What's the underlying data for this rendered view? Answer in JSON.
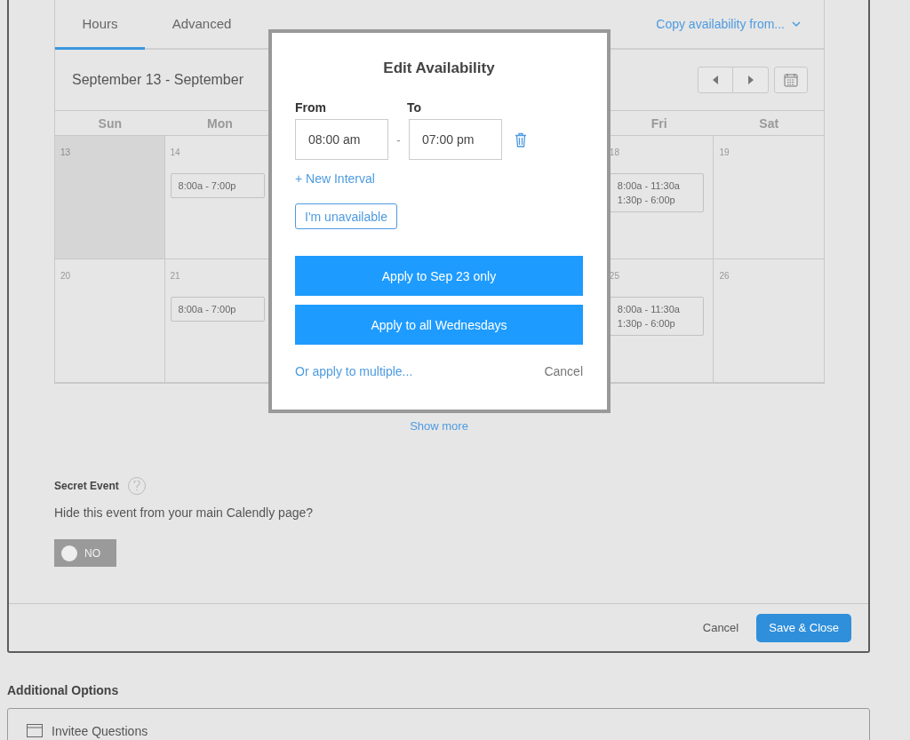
{
  "availability": {
    "tabs": [
      {
        "label": "Hours",
        "selected": true
      },
      {
        "label": "Advanced",
        "selected": false
      }
    ],
    "copy_link": "Copy availability from...",
    "date_range": "September 13 - September",
    "days_before_dialog": [
      {
        "label": "Sun"
      },
      {
        "label": "Mon"
      }
    ],
    "days_after_dialog": [
      {
        "label": "Fri"
      },
      {
        "label": "Sat"
      }
    ],
    "weeks": [
      {
        "before_dialog": [
          {
            "date": "13",
            "past": true
          },
          {
            "date": "14",
            "past": false,
            "intervals": [
              "8:00a - 7:00p"
            ]
          }
        ],
        "after_dialog": [
          {
            "date": "18",
            "past": false,
            "intervals": [
              "8:00a - 11:30a",
              "1:30p - 6:00p"
            ]
          },
          {
            "date": "19",
            "past": false
          }
        ]
      },
      {
        "before_dialog": [
          {
            "date": "20",
            "past": false
          },
          {
            "date": "21",
            "past": false,
            "intervals": [
              "8:00a - 7:00p"
            ]
          }
        ],
        "after_dialog": [
          {
            "date": "25",
            "past": false,
            "intervals": [
              "8:00a - 11:30a",
              "1:30p - 6:00p"
            ]
          },
          {
            "date": "26",
            "past": false
          }
        ]
      }
    ],
    "show_more": "Show more"
  },
  "secret_event": {
    "label": "Secret Event",
    "question": "Hide this event from your main Calendly page?",
    "toggle": {
      "on": false,
      "label": "NO"
    }
  },
  "footer": {
    "cancel": "Cancel",
    "save": "Save & Close"
  },
  "additional_options": {
    "title": "Additional Options",
    "items": [
      {
        "label": "Invitee Questions"
      }
    ]
  },
  "dialog": {
    "title": "Edit Availability",
    "from_label": "From",
    "to_label": "To",
    "from_value": "08:00 am",
    "to_value": "07:00 pm",
    "separator": "-",
    "new_interval": "+ New Interval",
    "unavailable": "I'm unavailable",
    "apply_buttons": [
      "Apply to Sep 23 only",
      "Apply to all Wednesdays"
    ],
    "multiple_link": "Or apply to multiple...",
    "cancel": "Cancel"
  }
}
